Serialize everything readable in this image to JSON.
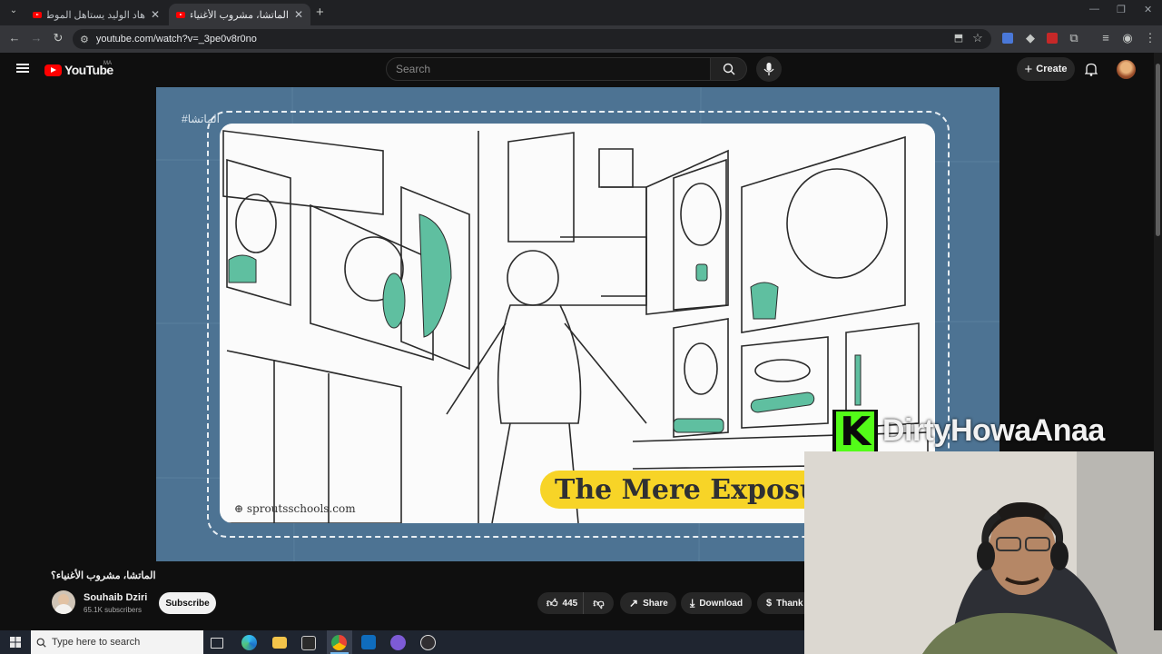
{
  "browser": {
    "tabs": [
      {
        "label": "هاد الوليد يستاهل الموطوز❤ - Yo",
        "active": false
      },
      {
        "label": "الماتشا، مشروب الأغنياء؟ - YouTube",
        "active": true
      }
    ],
    "new_tab_symbol": "+",
    "url": "youtube.com/watch?v=_3pe0v8r0no",
    "icons": [
      "back-icon",
      "forward-icon",
      "reload-icon",
      "site-info-icon",
      "install-icon",
      "star-icon",
      "translate-icon",
      "extension-icon",
      "puzzle-icon",
      "media-icon",
      "profile-icon",
      "menu-icon"
    ]
  },
  "youtube": {
    "logo_text": "YouTube",
    "country": "MA",
    "search_placeholder": "Search",
    "create_label": "Create",
    "video": {
      "hashtag": "#الماتشا",
      "caption": "The Mere Exposur",
      "watermark": "sproutsschools.com",
      "title": "الماتشا، مشروب الأغنياء؟"
    },
    "channel": {
      "name": "Souhaib Dziri",
      "subscribers": "65.1K subscribers"
    },
    "subscribe_label": "Subscribe",
    "likes": "445",
    "share_label": "Share",
    "download_label": "Download",
    "thanks_label": "Thank"
  },
  "overlay": {
    "logo_letter": "K",
    "streamer_name": "DirtyHowaAnaa"
  },
  "taskbar": {
    "search_placeholder": "Type here to search",
    "apps": [
      "task-view-icon",
      "edge-icon",
      "file-explorer-icon",
      "store-icon",
      "chrome-icon",
      "outlook-icon",
      "discord-icon",
      "obs-icon"
    ]
  },
  "colors": {
    "yt_red": "#ff0000",
    "video_bg": "#4d7393",
    "caption_bg": "#f7d427",
    "accent_green": "#5fbfa0",
    "kick_green": "#53fc18"
  }
}
